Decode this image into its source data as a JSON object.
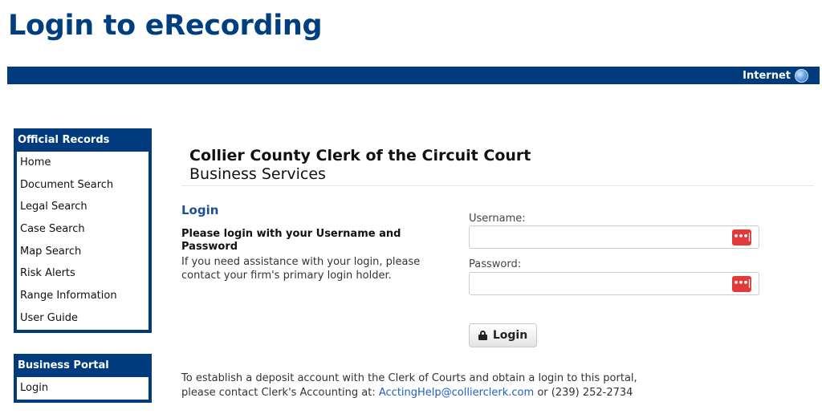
{
  "page_title": "Login to eRecording",
  "top_bar": {
    "zone_label": "Internet"
  },
  "nav": {
    "official_records": {
      "title": "Official Records",
      "items": [
        "Home",
        "Document Search",
        "Legal Search",
        "Case Search",
        "Map Search",
        "Risk Alerts",
        "Range Information",
        "User Guide"
      ]
    },
    "business_portal": {
      "title": "Business Portal",
      "items": [
        "Login"
      ]
    }
  },
  "header": {
    "title": "Collier County Clerk of the Circuit Court",
    "subtitle": "Business Services"
  },
  "login": {
    "title": "Login",
    "instruction": "Please login with your Username and Password",
    "help": "If you need assistance with your login, please contact your firm's primary login holder.",
    "username_label": "Username:",
    "username_value": "",
    "password_label": "Password:",
    "password_value": "",
    "password_manager_glyph": "•••|",
    "button_label": "Login"
  },
  "footer": {
    "line1": "To establish a deposit account with the Clerk of Courts and obtain a login to this portal,",
    "line2_prefix": "please contact Clerk's Accounting at: ",
    "email": "AcctingHelp@collierclerk.com",
    "line2_suffix": " or (239) 252-2734"
  },
  "colors": {
    "brand": "#003c7d",
    "title": "#003f7f",
    "link": "#1f5fbf",
    "password_badge": "#e03a3a"
  }
}
